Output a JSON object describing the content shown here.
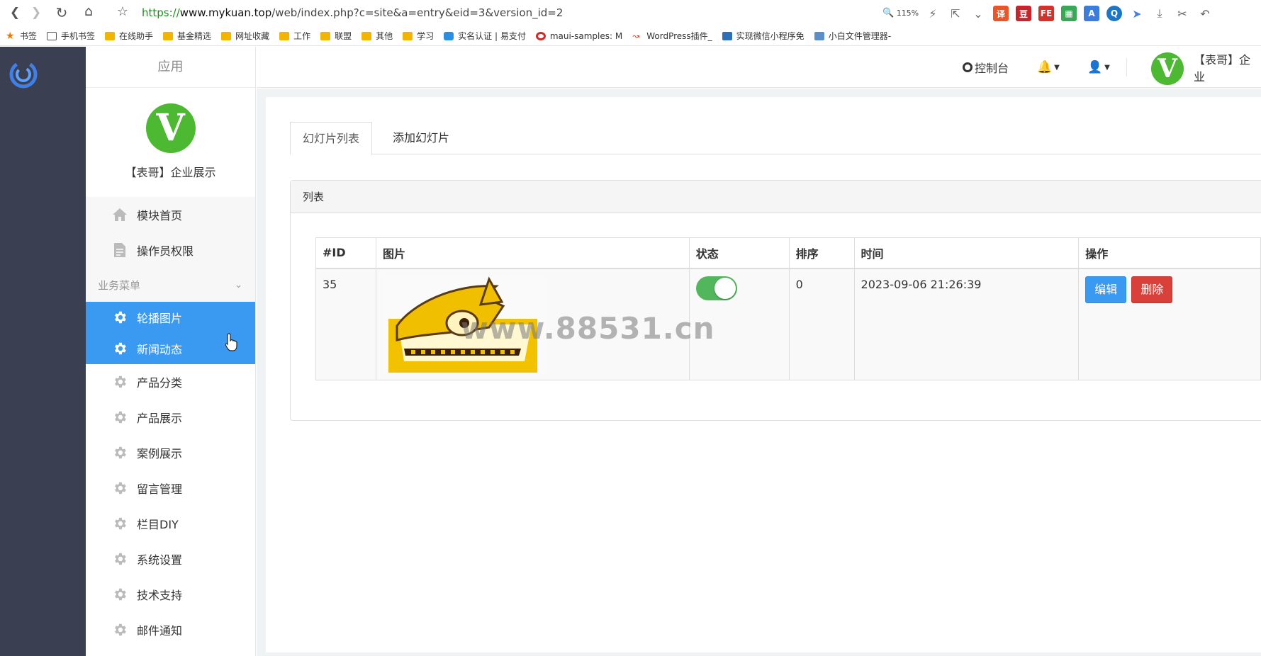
{
  "browser": {
    "url_proto": "https://",
    "url_host": "www.mykuan.top",
    "url_rest": "/web/index.php?c=site&a=entry&eid=3&version_id=2",
    "zoom": "115%",
    "bookmarks": [
      "书签",
      "手机书签",
      "在线助手",
      "基金精选",
      "网址收藏",
      "工作",
      "联盟",
      "其他",
      "学习",
      "实名认证 | 易支付",
      "maui-samples: M",
      "WordPress插件_",
      "实现微信小程序免",
      "小白文件管理器-"
    ]
  },
  "sidebar": {
    "header": "应用",
    "avatar_letter": "V",
    "profile_name": "【表哥】企业展示",
    "top_items": [
      {
        "label": "模块首页",
        "icon": "home-icon"
      },
      {
        "label": "操作员权限",
        "icon": "document-icon"
      }
    ],
    "section_title": "业务菜单",
    "items": [
      {
        "label": "轮播图片",
        "active": true
      },
      {
        "label": "新闻动态",
        "active": true
      },
      {
        "label": "产品分类",
        "active": false
      },
      {
        "label": "产品展示",
        "active": false
      },
      {
        "label": "案例展示",
        "active": false
      },
      {
        "label": "留言管理",
        "active": false
      },
      {
        "label": "栏目DIY",
        "active": false
      },
      {
        "label": "系统设置",
        "active": false
      },
      {
        "label": "技术支持",
        "active": false
      },
      {
        "label": "邮件通知",
        "active": false
      }
    ]
  },
  "topbar": {
    "console": "控制台",
    "avatar_letter": "V",
    "user_name": "【表哥】企业"
  },
  "tabs": [
    "幻灯片列表",
    "添加幻灯片"
  ],
  "list": {
    "title": "列表",
    "columns": [
      "#ID",
      "图片",
      "状态",
      "排序",
      "时间",
      "操作"
    ],
    "rows": [
      {
        "id": "35",
        "status_on": true,
        "order": "0",
        "time": "2023-09-06 21:26:39",
        "edit": "编辑",
        "delete": "删除"
      }
    ]
  },
  "watermark": "www.88531.cn",
  "colors": {
    "accent": "#3a99f0",
    "danger": "#d9403a",
    "toggle": "#52b65d",
    "avatar": "#4db832",
    "dark_bar": "#3a3f51"
  }
}
